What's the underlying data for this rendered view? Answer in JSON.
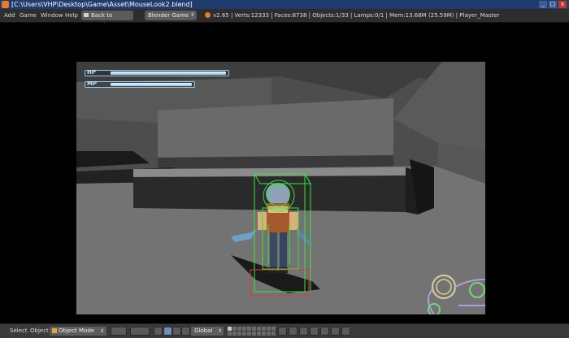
{
  "titlebar": {
    "title": "[C:\\Users\\VHP\\Desktop\\Game\\Asset\\MouseLook2.blend]",
    "minimize": "_",
    "maximize": "□",
    "close": "x"
  },
  "menu": {
    "items": [
      "Add",
      "Game",
      "Window",
      "Help"
    ],
    "back_button": "Back to Previous",
    "engine": "Blender Game",
    "stats": "v2.65 | Verts:12333 | Faces:8738 | Objects:1/33 | Lamps:0/1 | Mem:13.68M (25.59M) | Player_Master"
  },
  "hud": {
    "hp_label": "HP",
    "mp_label": "MP",
    "hp_level": 1.0,
    "mp_level": 1.0
  },
  "toolbar": {
    "select": "Select",
    "object": "Object",
    "mode": "Object Mode",
    "orientation": "Global"
  },
  "colors": {
    "title_bar": "#1e3c6e",
    "header": "#2d2d2d",
    "bounds_green": "#35e53a",
    "bounds_red": "#e23a3a",
    "hud_outline": "#9ecce8"
  }
}
